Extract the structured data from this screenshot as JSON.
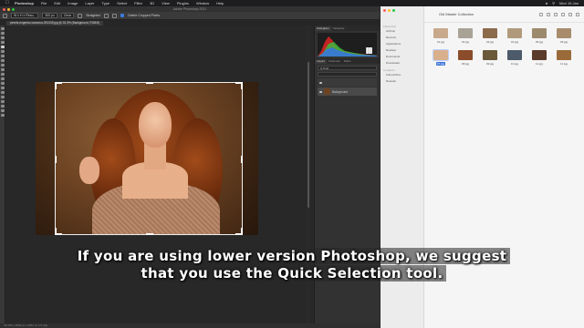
{
  "menubar": {
    "app": "Photoshop",
    "items": [
      "File",
      "Edit",
      "Image",
      "Layer",
      "Type",
      "Select",
      "Filter",
      "3D",
      "View",
      "Plugins",
      "Window",
      "Help"
    ],
    "clock": "Mon 15 Jan"
  },
  "photoshop": {
    "window_title": "Adobe Photoshop 2021",
    "options": {
      "ratio": "W x H x Reso...",
      "resolution": "300 px",
      "clear_label": "Clear",
      "straighten_label": "Straighten",
      "delete_cropped_label": "Delete Cropped Pixels"
    },
    "doc_tab": "pexels-eugenia-rozanova-391339.jpg @ 33.3% (Background, RGB/8)",
    "status": "33.33%  |  4000 px x 2667 px (72 ppi)",
    "panels": {
      "top_tabs": [
        "Histogram",
        "Navigator"
      ],
      "layer_tabs": [
        "Layers",
        "Channels",
        "Paths"
      ],
      "kind_label": "Q Kind",
      "layers": [
        {
          "name": "",
          "thumb": "grid"
        },
        {
          "name": "Background",
          "thumb": "photo"
        }
      ]
    }
  },
  "finder": {
    "title": "Old Master Collection",
    "sidebar_groups": [
      {
        "label": "Favourites",
        "items": [
          "AirDrop",
          "Recents",
          "Applications",
          "Desktop",
          "Documents",
          "Downloads"
        ]
      },
      {
        "label": "Locations",
        "items": [
          "iCloud Drive",
          "Network"
        ]
      }
    ],
    "files": [
      {
        "name": "01.jpg",
        "color": "#c8a98c"
      },
      {
        "name": "02.jpg",
        "color": "#a9a396"
      },
      {
        "name": "03.jpg",
        "color": "#8c6a4c"
      },
      {
        "name": "04.jpg",
        "color": "#b19a7c"
      },
      {
        "name": "05.jpg",
        "color": "#9c8a6c"
      },
      {
        "name": "06.jpg",
        "color": "#a88c6c"
      },
      {
        "name": "07.jpg",
        "color": "#d9b08c",
        "selected": true
      },
      {
        "name": "08.jpg",
        "color": "#8a4c2a"
      },
      {
        "name": "09.jpg",
        "color": "#6a5a3a"
      },
      {
        "name": "10.jpg",
        "color": "#4c5a6a"
      },
      {
        "name": "11.jpg",
        "color": "#5a3a2a"
      },
      {
        "name": "12.jpg",
        "color": "#9a6a3a"
      }
    ]
  },
  "subtitle": {
    "line1": "If you are using lower version Photoshop, we suggest",
    "line2": "that you use the Quick Selection tool."
  }
}
